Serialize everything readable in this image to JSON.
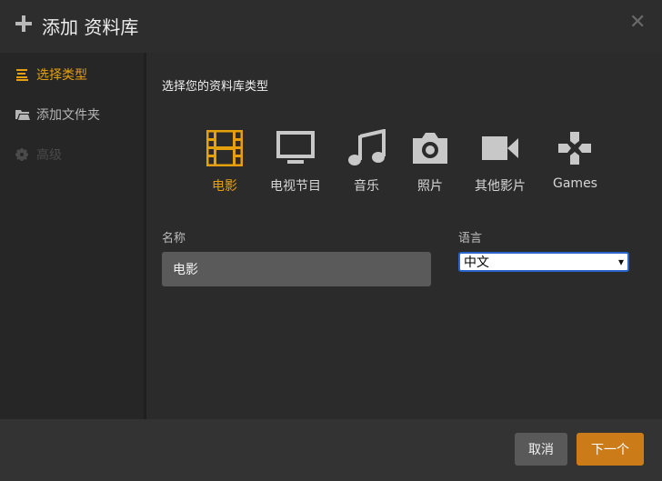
{
  "header": {
    "title": "添加 资料库"
  },
  "sidebar": {
    "items": [
      {
        "label": "选择类型",
        "icon": "list-icon",
        "state": "active"
      },
      {
        "label": "添加文件夹",
        "icon": "folder-icon",
        "state": "normal"
      },
      {
        "label": "高级",
        "icon": "gear-icon",
        "state": "disabled"
      }
    ]
  },
  "main": {
    "prompt": "选择您的资料库类型",
    "types": [
      {
        "label": "电影",
        "icon": "film-icon",
        "selected": true
      },
      {
        "label": "电视节目",
        "icon": "tv-icon",
        "selected": false
      },
      {
        "label": "音乐",
        "icon": "music-icon",
        "selected": false
      },
      {
        "label": "照片",
        "icon": "camera-icon",
        "selected": false
      },
      {
        "label": "其他影片",
        "icon": "video-camera-icon",
        "selected": false
      },
      {
        "label": "Games",
        "icon": "gamepad-icon",
        "selected": false
      }
    ],
    "name_label": "名称",
    "name_value": "电影",
    "language_label": "语言",
    "language_value": "中文"
  },
  "footer": {
    "cancel_label": "取消",
    "next_label": "下一个"
  },
  "colors": {
    "accent": "#e5a00d",
    "next_button": "#cc7b19",
    "icon_gray": "#c8c8c8"
  }
}
